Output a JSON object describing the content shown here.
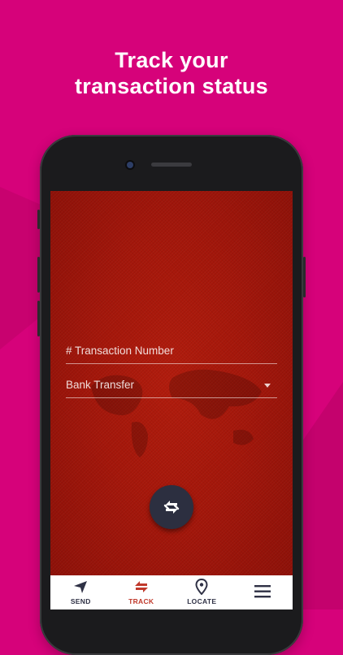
{
  "promo": {
    "headline_line1": "Track your",
    "headline_line2": "transaction status"
  },
  "form": {
    "transaction_number_placeholder": "# Transaction Number",
    "transfer_type_value": "Bank Transfer"
  },
  "action_button": {
    "icon": "exchange-icon"
  },
  "bottom_nav": {
    "items": [
      {
        "label": "SEND",
        "icon": "send-icon",
        "active": false
      },
      {
        "label": "TRACK",
        "icon": "track-icon",
        "active": true
      },
      {
        "label": "LOCATE",
        "icon": "location-pin-icon",
        "active": false
      },
      {
        "label": "",
        "icon": "menu-icon",
        "active": false
      }
    ]
  },
  "colors": {
    "background": "#d6027a",
    "screen_red": "#a3160a",
    "accent_red": "#c0392b",
    "fab": "#2c2f40",
    "nav_text": "#2f3145"
  }
}
